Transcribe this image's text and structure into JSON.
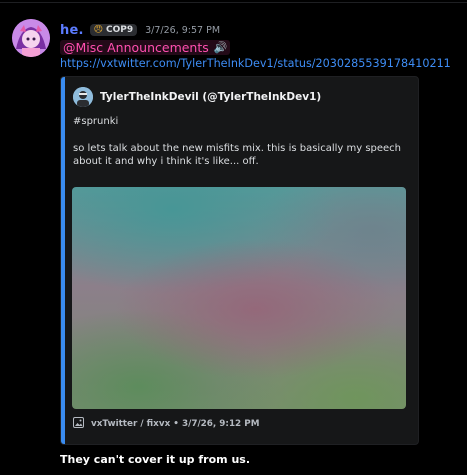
{
  "message": {
    "username": "he.",
    "tag": {
      "icon": "angry-face-icon",
      "label": "COP9"
    },
    "timestamp": "3/7/26, 9:57 PM",
    "mention": {
      "label": "@Misc Announcements",
      "icon": "speaker-icon"
    },
    "link": "https://vxtwitter.com/TylerTheInkDev1/status/2030285539178410211",
    "colors": {
      "username": "#5c7cff",
      "mention": "#ff4fb0",
      "link": "#3e8df5",
      "embed_accent": "#3a8cf0"
    }
  },
  "embed": {
    "author": "TylerTheInkDevil (@TylerTheInkDev1)",
    "description": {
      "hashtag": "#sprunki",
      "line1": "so lets talk about the new misfits mix. this is basically my speech",
      "line2": "about it and why i think it's like... off."
    },
    "footer": {
      "icon": "image-icon",
      "text": "vxTwitter / fixvx • 3/7/26, 9:12 PM"
    }
  },
  "followup": {
    "text": "They can't cover it up from us."
  }
}
